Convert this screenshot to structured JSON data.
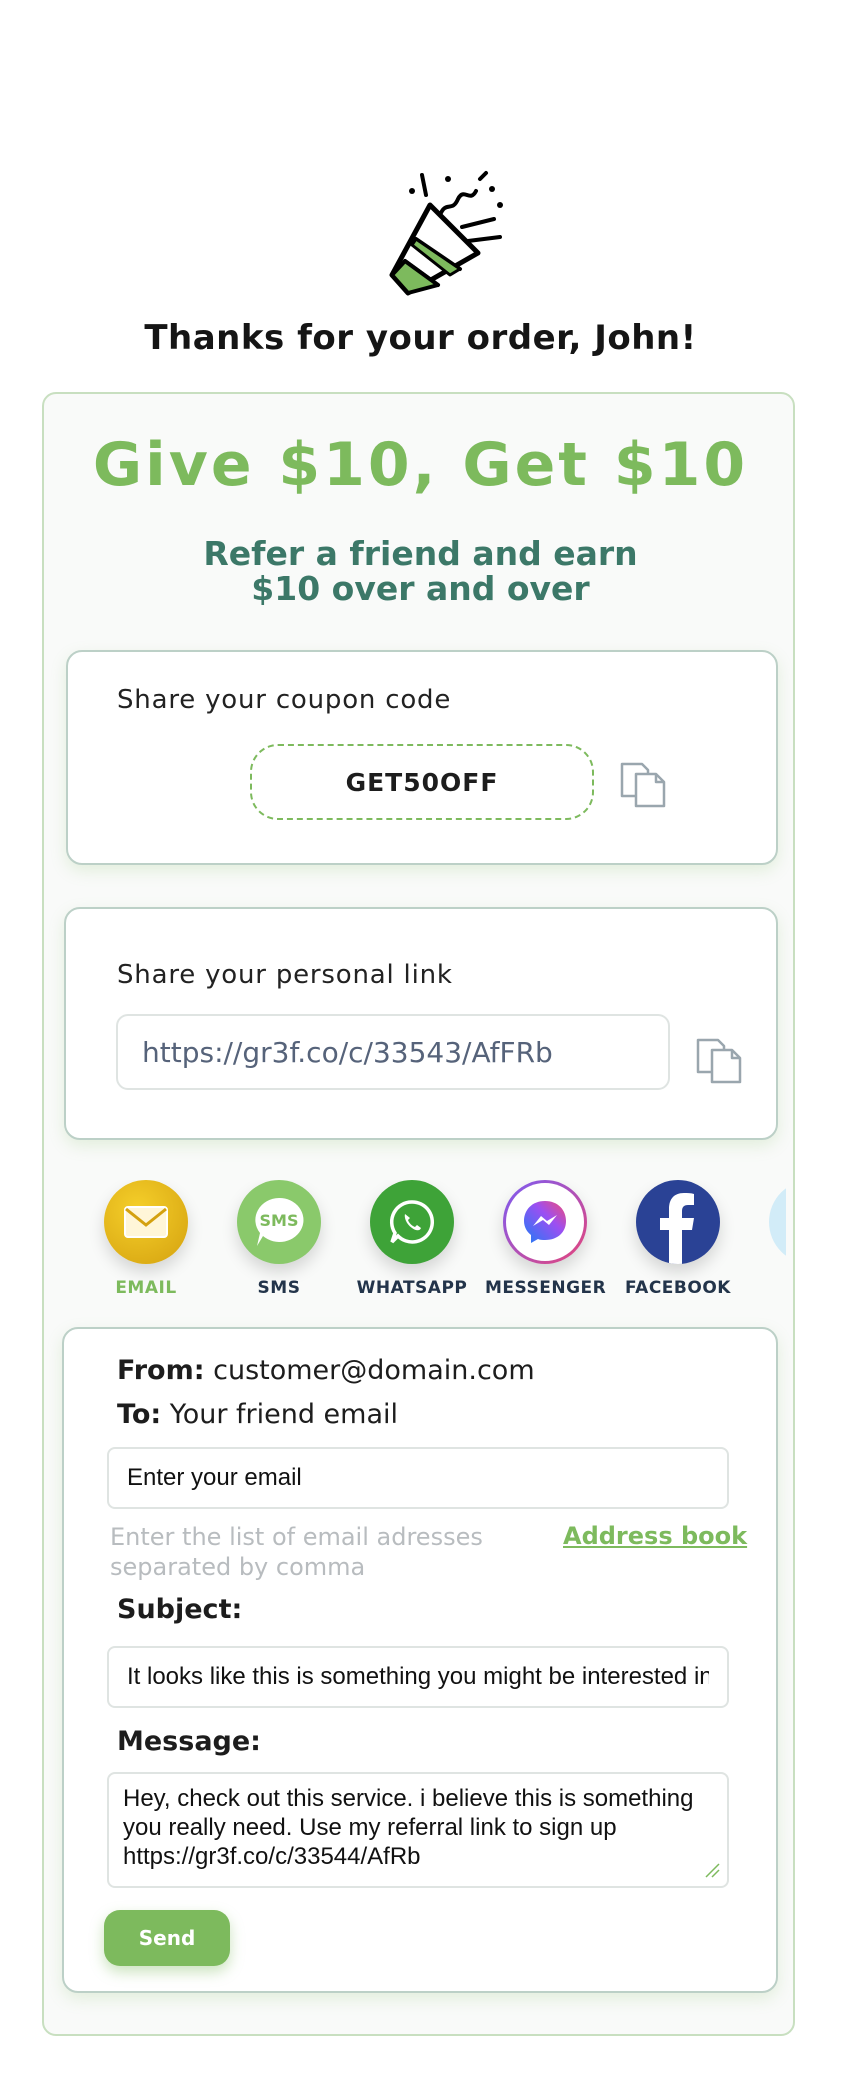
{
  "header": {
    "greeting": "Thanks for your order, John!"
  },
  "promo": {
    "headline": "Give $10, Get $10",
    "subline_1": "Refer a friend and earn",
    "subline_2": "$10 over and over"
  },
  "coupon": {
    "label": "Share your coupon code",
    "code": "GET50OFF"
  },
  "personal_link": {
    "label": "Share your personal link",
    "url": "https://gr3f.co/c/33543/AfFRb"
  },
  "share": {
    "buttons": [
      {
        "label": "EMAIL",
        "icon": "envelope-icon",
        "color": "#e6b317",
        "label_color": "#7dba5d"
      },
      {
        "label": "SMS",
        "icon": "sms-bubble-icon",
        "color": "#8ac96b",
        "label_color": "#23344a"
      },
      {
        "label": "WHATSAPP",
        "icon": "whatsapp-icon",
        "color": "#3ea338",
        "label_color": "#23344a"
      },
      {
        "label": "MESSENGER",
        "icon": "messenger-icon",
        "color": "#ffffff",
        "label_color": "#23344a"
      },
      {
        "label": "FACEBOOK",
        "icon": "facebook-icon",
        "color": "#2a4295",
        "label_color": "#23344a"
      },
      {
        "label": "",
        "icon": "telegram-icon",
        "color": "#d2ecf8",
        "label_color": "#23344a"
      }
    ]
  },
  "email_form": {
    "from_label": "From:",
    "from_value": "customer@domain.com",
    "to_label": "To:",
    "to_value": "Your friend email",
    "email_value": "Enter your email",
    "hint": "Enter the list of email adresses separated by comma",
    "hint_line_1": "Enter the list of email adresses",
    "hint_line_2": "separated by comma",
    "address_book": "Address book",
    "subject_label": "Subject:",
    "subject_value": "It looks like this is something you might be interested in",
    "message_label": "Message:",
    "message_value": "Hey, check out this service. i believe this is something you really need. Use my referral link to sign up https://gr3f.co/c/33544/AfRb",
    "send_label": "Send"
  },
  "colors": {
    "brand_green": "#7dba5d",
    "teal_text": "#3c7868",
    "card_border": "#bcd0c7"
  }
}
